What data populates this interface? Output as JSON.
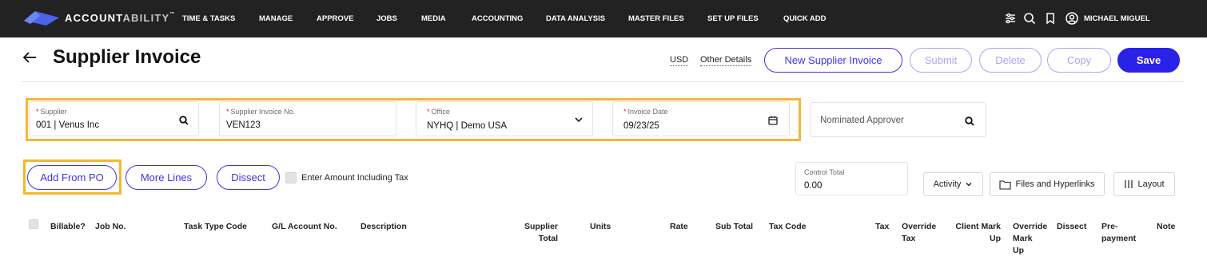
{
  "nav": {
    "brand_bold": "ACCOUNT",
    "brand_light": "ABILITY",
    "brand_tm": "™",
    "items": [
      "TIME & TASKS",
      "MANAGE",
      "APPROVE",
      "JOBS",
      "MEDIA",
      "ACCOUNTING",
      "DATA ANALYSIS",
      "MASTER FILES",
      "SET UP FILES",
      "QUICK ADD"
    ],
    "user": "MICHAEL MIGUEL",
    "icons": [
      "sliders-icon",
      "search-icon",
      "bookmark-icon",
      "user-circle-icon"
    ]
  },
  "header": {
    "title": "Supplier Invoice",
    "currency": "USD",
    "other_details": "Other Details",
    "buttons": {
      "new": "New Supplier Invoice",
      "submit": "Submit",
      "delete": "Delete",
      "copy": "Copy",
      "save": "Save"
    }
  },
  "form": {
    "required_mark": "*",
    "supplier": {
      "label": "Supplier",
      "value": "001 | Venus Inc"
    },
    "invoice_no": {
      "label": "Supplier Invoice No.",
      "value": "VEN123"
    },
    "office": {
      "label": "Office",
      "value": "NYHQ | Demo USA"
    },
    "invoice_date": {
      "label": "Invoice Date",
      "value": "09/23/25"
    },
    "approver": {
      "placeholder": "Nominated Approver"
    }
  },
  "actions": {
    "add_from_po": "Add From PO",
    "more_lines": "More Lines",
    "dissect": "Dissect",
    "enter_incl_tax": "Enter Amount Including Tax",
    "control_total": {
      "label": "Control Total",
      "value": "0.00"
    },
    "activity": "Activity",
    "files": "Files and Hyperlinks",
    "layout": "Layout"
  },
  "table": {
    "headers": {
      "billable": "Billable?",
      "job_no": "Job No.",
      "task_type": "Task Type Code",
      "gl_account": "G/L Account No.",
      "description": "Description",
      "supplier_total_1": "Supplier",
      "supplier_total_2": "Total",
      "units": "Units",
      "rate": "Rate",
      "sub_total": "Sub Total",
      "tax_code": "Tax Code",
      "tax": "Tax",
      "override_tax_1": "Override",
      "override_tax_2": "Tax",
      "client_markup_1": "Client Mark",
      "client_markup_2": "Up",
      "override_markup_1": "Override",
      "override_markup_2": "Mark",
      "override_markup_3": "Up",
      "dissect": "Dissect",
      "prepayment_1": "Pre-",
      "prepayment_2": "payment",
      "note": "Note"
    }
  },
  "colors": {
    "accent": "#3d35e3",
    "highlight": "#f5b731",
    "nav_bg": "#222222",
    "required": "#e12020"
  }
}
